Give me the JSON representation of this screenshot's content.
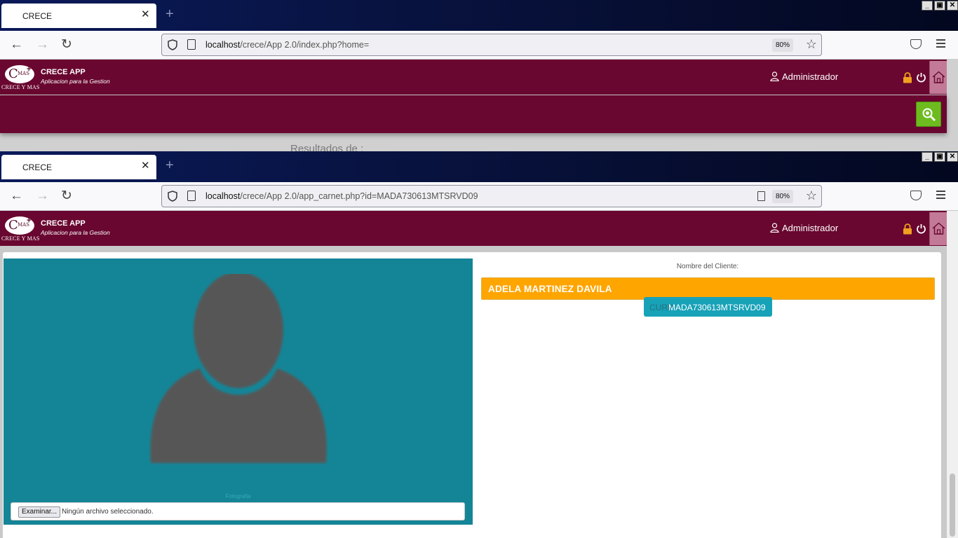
{
  "window1": {
    "tab": {
      "title": "CRECE",
      "close": "✕"
    },
    "url": {
      "host": "localhost",
      "path": "/crece/App 2.0/index.php?home="
    },
    "zoom": "80%",
    "header": {
      "app_title": "CRECE APP",
      "app_subtitle": "Aplicacion para la Gestion",
      "logo_text": "CRECE Y MAS",
      "logo_mas": "MAS",
      "user": "Administrador"
    },
    "results_text": "Resultados de :"
  },
  "window2": {
    "tab": {
      "title": "CRECE",
      "close": "✕"
    },
    "url": {
      "host": "localhost",
      "path": "/crece/App 2.0/app_carnet.php?id=MADA730613MTSRVD09"
    },
    "zoom": "80%",
    "header": {
      "app_title": "CRECE APP",
      "app_subtitle": "Aplicacion para la Gestion",
      "logo_text": "CRECE Y MAS",
      "logo_mas": "MAS",
      "user": "Administrador"
    },
    "photo": {
      "label": "Fotografia",
      "file_button": "Examinar...",
      "file_status": "Ningún archivo seleccionado."
    },
    "client": {
      "label": "Nombre del Cliente:",
      "name": "ADELA MARTINEZ DAVILA",
      "curp_key": "CURP",
      "curp_value": "MADA730613MTSRVD09"
    }
  },
  "colors": {
    "header": "#690730",
    "photo_panel": "#148597",
    "name_bar": "#ffa500",
    "curp_badge": "#17a2b8",
    "search_button": "#6dbb1e"
  },
  "icons": [
    "back-arrow-icon",
    "forward-arrow-icon",
    "reload-icon",
    "shield-icon",
    "page-icon",
    "star-icon",
    "pocket-icon",
    "menu-icon",
    "user-icon",
    "lock-icon",
    "power-icon",
    "home-icon",
    "search-icon",
    "reader-view-icon"
  ]
}
